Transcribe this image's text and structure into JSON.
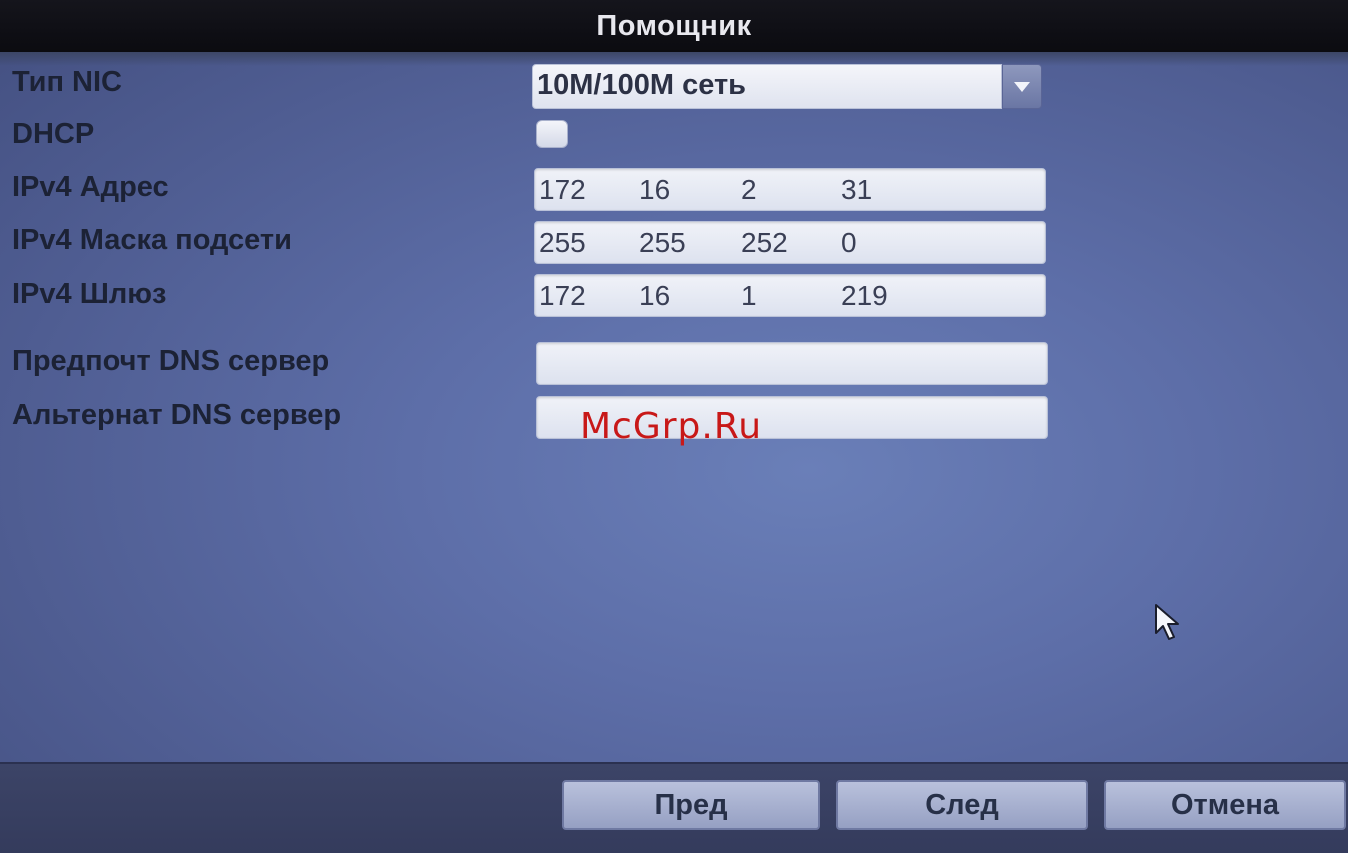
{
  "dialog": {
    "title": "Помощник"
  },
  "form": {
    "nic_type": {
      "label": "Тип NIC",
      "value": "10M/100M сеть"
    },
    "dhcp": {
      "label": "DHCP",
      "checked": false
    },
    "ipv4_address": {
      "label": "IPv4 Адрес",
      "octets": [
        "172",
        "16",
        "2",
        "31"
      ]
    },
    "ipv4_mask": {
      "label": "IPv4 Маска подсети",
      "octets": [
        "255",
        "255",
        "252",
        "0"
      ]
    },
    "ipv4_gateway": {
      "label": "IPv4 Шлюз",
      "octets": [
        "172",
        "16",
        "1",
        "219"
      ]
    },
    "preferred_dns": {
      "label": "Предпочт DNS сервер",
      "value": ""
    },
    "alternate_dns": {
      "label": "Альтернат DNS сервер",
      "value": ""
    }
  },
  "buttons": {
    "prev": "Пред",
    "next": "След",
    "cancel": "Отмена"
  },
  "watermark": "McGrp.Ru",
  "colors": {
    "title_bar": "#0b0b10",
    "panel": "#5d6ea8",
    "footer": "#343b5c",
    "watermark": "#c81818"
  }
}
